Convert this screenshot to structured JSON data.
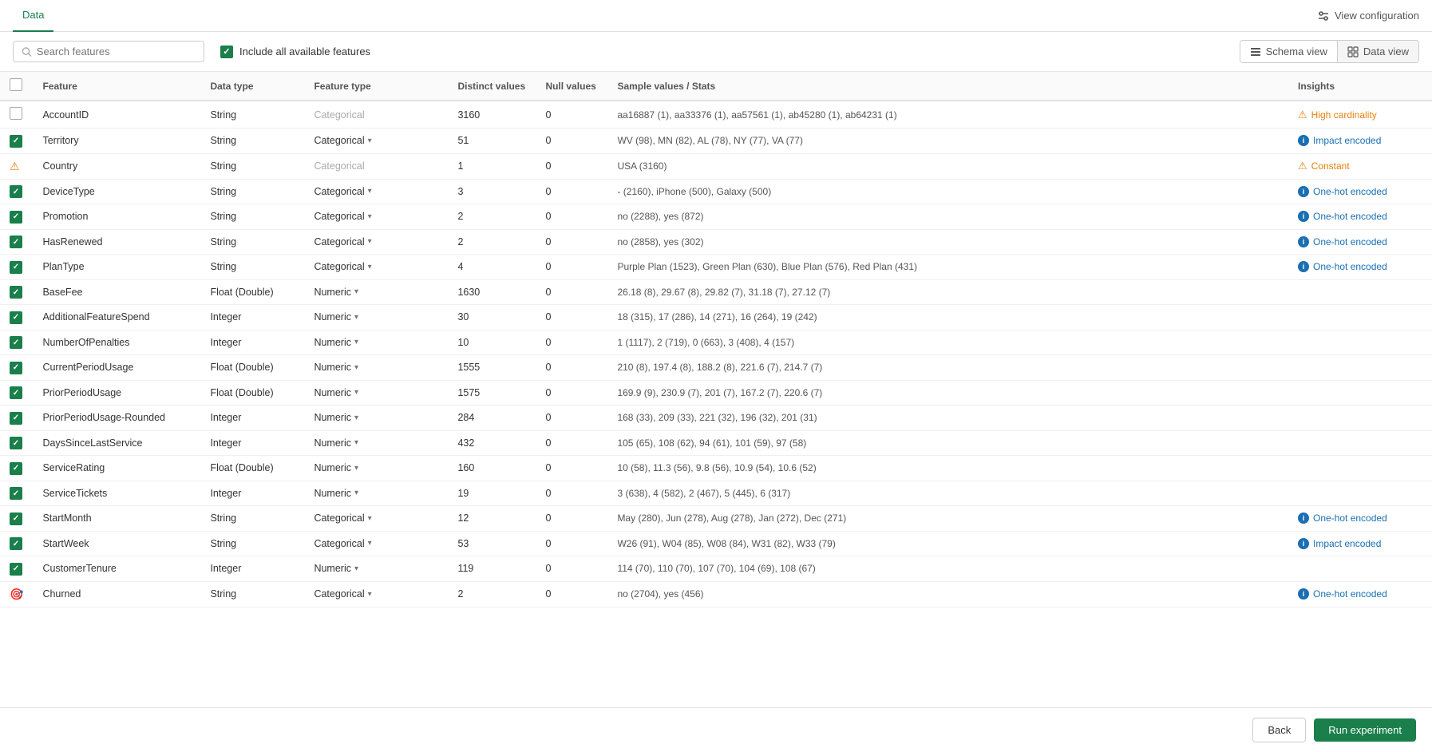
{
  "nav": {
    "tab_label": "Data",
    "view_config_label": "View configuration"
  },
  "toolbar": {
    "search_placeholder": "Search features",
    "include_all_label": "Include all available features",
    "schema_view_label": "Schema view",
    "data_view_label": "Data view"
  },
  "table": {
    "columns": [
      "",
      "Feature",
      "Data type",
      "Feature type",
      "Distinct values",
      "Null values",
      "Sample values / Stats",
      "Insights"
    ],
    "rows": [
      {
        "checked": "unchecked",
        "feature": "AccountID",
        "datatype": "String",
        "featuretype": "Categorical",
        "featuretype_active": false,
        "distinct": "3160",
        "nulls": "0",
        "sample": "aa16887 (1), aa33376 (1), aa57561 (1), ab45280 (1), ab64231 (1)",
        "insight_type": "warning",
        "insight": "High cardinality"
      },
      {
        "checked": "checked",
        "feature": "Territory",
        "datatype": "String",
        "featuretype": "Categorical",
        "featuretype_active": true,
        "distinct": "51",
        "nulls": "0",
        "sample": "WV (98), MN (82), AL (78), NY (77), VA (77)",
        "insight_type": "info",
        "insight": "Impact encoded"
      },
      {
        "checked": "warning",
        "feature": "Country",
        "datatype": "String",
        "featuretype": "Categorical",
        "featuretype_active": false,
        "distinct": "1",
        "nulls": "0",
        "sample": "USA (3160)",
        "insight_type": "warning",
        "insight": "Constant"
      },
      {
        "checked": "checked",
        "feature": "DeviceType",
        "datatype": "String",
        "featuretype": "Categorical",
        "featuretype_active": true,
        "distinct": "3",
        "nulls": "0",
        "sample": "- (2160), iPhone (500), Galaxy (500)",
        "insight_type": "info",
        "insight": "One-hot encoded"
      },
      {
        "checked": "checked",
        "feature": "Promotion",
        "datatype": "String",
        "featuretype": "Categorical",
        "featuretype_active": true,
        "distinct": "2",
        "nulls": "0",
        "sample": "no (2288), yes (872)",
        "insight_type": "info",
        "insight": "One-hot encoded"
      },
      {
        "checked": "checked",
        "feature": "HasRenewed",
        "datatype": "String",
        "featuretype": "Categorical",
        "featuretype_active": true,
        "distinct": "2",
        "nulls": "0",
        "sample": "no (2858), yes (302)",
        "insight_type": "info",
        "insight": "One-hot encoded"
      },
      {
        "checked": "checked",
        "feature": "PlanType",
        "datatype": "String",
        "featuretype": "Categorical",
        "featuretype_active": true,
        "distinct": "4",
        "nulls": "0",
        "sample": "Purple Plan (1523), Green Plan (630), Blue Plan (576), Red Plan (431)",
        "insight_type": "info",
        "insight": "One-hot encoded"
      },
      {
        "checked": "checked",
        "feature": "BaseFee",
        "datatype": "Float (Double)",
        "featuretype": "Numeric",
        "featuretype_active": true,
        "distinct": "1630",
        "nulls": "0",
        "sample": "26.18 (8), 29.67 (8), 29.82 (7), 31.18 (7), 27.12 (7)",
        "insight_type": "none",
        "insight": ""
      },
      {
        "checked": "checked",
        "feature": "AdditionalFeatureSpend",
        "datatype": "Integer",
        "featuretype": "Numeric",
        "featuretype_active": true,
        "distinct": "30",
        "nulls": "0",
        "sample": "18 (315), 17 (286), 14 (271), 16 (264), 19 (242)",
        "insight_type": "none",
        "insight": ""
      },
      {
        "checked": "checked",
        "feature": "NumberOfPenalties",
        "datatype": "Integer",
        "featuretype": "Numeric",
        "featuretype_active": true,
        "distinct": "10",
        "nulls": "0",
        "sample": "1 (1117), 2 (719), 0 (663), 3 (408), 4 (157)",
        "insight_type": "none",
        "insight": ""
      },
      {
        "checked": "checked",
        "feature": "CurrentPeriodUsage",
        "datatype": "Float (Double)",
        "featuretype": "Numeric",
        "featuretype_active": true,
        "distinct": "1555",
        "nulls": "0",
        "sample": "210 (8), 197.4 (8), 188.2 (8), 221.6 (7), 214.7 (7)",
        "insight_type": "none",
        "insight": ""
      },
      {
        "checked": "checked",
        "feature": "PriorPeriodUsage",
        "datatype": "Float (Double)",
        "featuretype": "Numeric",
        "featuretype_active": true,
        "distinct": "1575",
        "nulls": "0",
        "sample": "169.9 (9), 230.9 (7), 201 (7), 167.2 (7), 220.6 (7)",
        "insight_type": "none",
        "insight": ""
      },
      {
        "checked": "checked",
        "feature": "PriorPeriodUsage-Rounded",
        "datatype": "Integer",
        "featuretype": "Numeric",
        "featuretype_active": true,
        "distinct": "284",
        "nulls": "0",
        "sample": "168 (33), 209 (33), 221 (32), 196 (32), 201 (31)",
        "insight_type": "none",
        "insight": ""
      },
      {
        "checked": "checked",
        "feature": "DaysSinceLastService",
        "datatype": "Integer",
        "featuretype": "Numeric",
        "featuretype_active": true,
        "distinct": "432",
        "nulls": "0",
        "sample": "105 (65), 108 (62), 94 (61), 101 (59), 97 (58)",
        "insight_type": "none",
        "insight": ""
      },
      {
        "checked": "checked",
        "feature": "ServiceRating",
        "datatype": "Float (Double)",
        "featuretype": "Numeric",
        "featuretype_active": true,
        "distinct": "160",
        "nulls": "0",
        "sample": "10 (58), 11.3 (56), 9.8 (56), 10.9 (54), 10.6 (52)",
        "insight_type": "none",
        "insight": ""
      },
      {
        "checked": "checked",
        "feature": "ServiceTickets",
        "datatype": "Integer",
        "featuretype": "Numeric",
        "featuretype_active": true,
        "distinct": "19",
        "nulls": "0",
        "sample": "3 (638), 4 (582), 2 (467), 5 (445), 6 (317)",
        "insight_type": "none",
        "insight": ""
      },
      {
        "checked": "checked",
        "feature": "StartMonth",
        "datatype": "String",
        "featuretype": "Categorical",
        "featuretype_active": true,
        "distinct": "12",
        "nulls": "0",
        "sample": "May (280), Jun (278), Aug (278), Jan (272), Dec (271)",
        "insight_type": "info",
        "insight": "One-hot encoded"
      },
      {
        "checked": "checked",
        "feature": "StartWeek",
        "datatype": "String",
        "featuretype": "Categorical",
        "featuretype_active": true,
        "distinct": "53",
        "nulls": "0",
        "sample": "W26 (91), W04 (85), W08 (84), W31 (82), W33 (79)",
        "insight_type": "info",
        "insight": "Impact encoded"
      },
      {
        "checked": "checked",
        "feature": "CustomerTenure",
        "datatype": "Integer",
        "featuretype": "Numeric",
        "featuretype_active": true,
        "distinct": "119",
        "nulls": "0",
        "sample": "114 (70), 110 (70), 107 (70), 104 (69), 108 (67)",
        "insight_type": "none",
        "insight": ""
      },
      {
        "checked": "target",
        "feature": "Churned",
        "datatype": "String",
        "featuretype": "Categorical",
        "featuretype_active": true,
        "distinct": "2",
        "nulls": "0",
        "sample": "no (2704), yes (456)",
        "insight_type": "info",
        "insight": "One-hot encoded"
      }
    ]
  },
  "footer": {
    "back_label": "Back",
    "run_label": "Run experiment"
  }
}
